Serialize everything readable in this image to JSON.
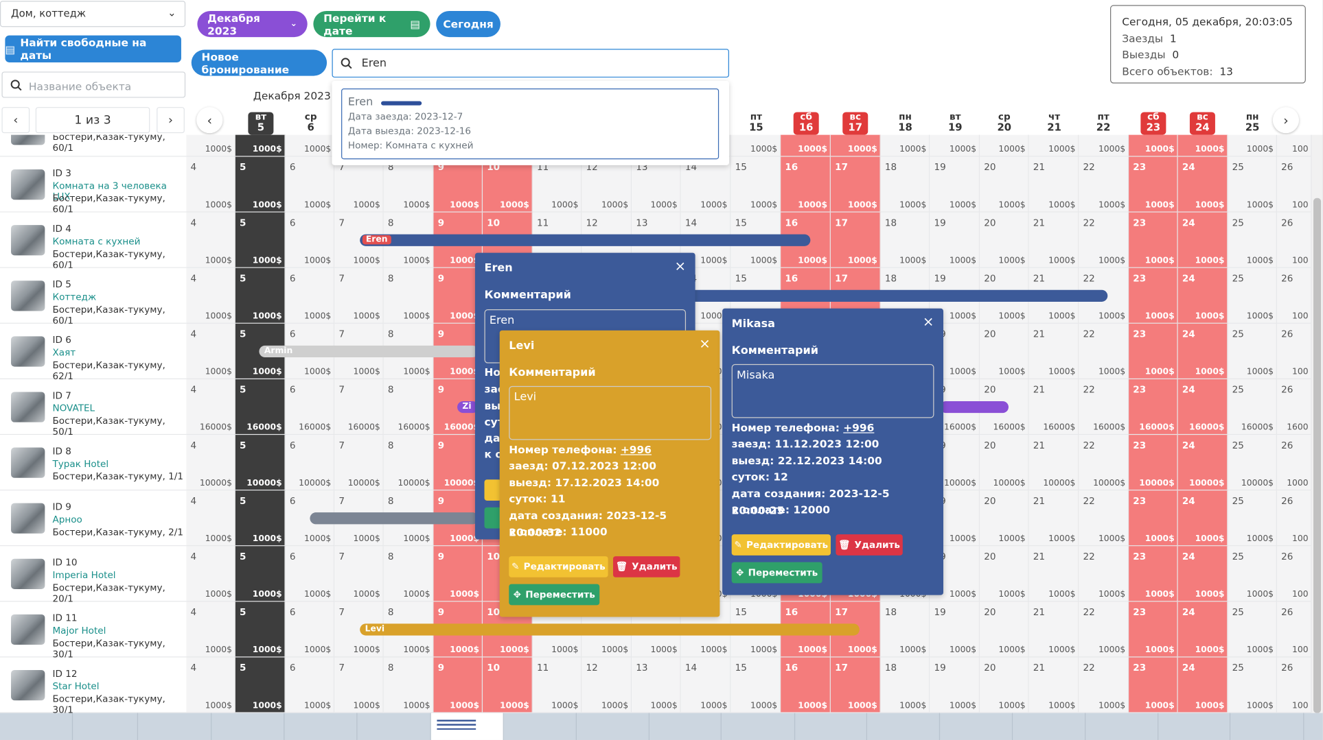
{
  "sidebar": {
    "type_select": "Дом, коттедж",
    "find_free": "Найти свободные на даты",
    "search_placeholder": "Название объекта",
    "pager": "1 из 3",
    "prev": "‹",
    "next": "›",
    "objects": [
      {
        "id": "",
        "name": "",
        "address": "Бостери,Казак-тукуму, 60/1"
      },
      {
        "id": "ID 3",
        "name": "Комната на 3 человека LUX",
        "address": "Бостери,Казак-тукуму, 60/1"
      },
      {
        "id": "ID 4",
        "name": "Комната с кухней",
        "address": "Бостери,Казак-тукуму, 60/1"
      },
      {
        "id": "ID 5",
        "name": "Коттедж",
        "address": "Бостери,Казак-тукуму, 60/1"
      },
      {
        "id": "ID 6",
        "name": "Хаят",
        "address": "Бостери,Казак-тукуму, 62/1"
      },
      {
        "id": "ID 7",
        "name": "NOVATEL",
        "address": "Бостери,Казак-тукуму, 50/1"
      },
      {
        "id": "ID 8",
        "name": "Турак Hotel",
        "address": "Бостери,Казак-тукуму, 1/1"
      },
      {
        "id": "ID 9",
        "name": "Арноо",
        "address": "Бостери,Казак-тукуму, 2/1"
      },
      {
        "id": "ID 10",
        "name": "Imperia Hotel",
        "address": "Бостери,Казак-тукуму, 20/1"
      },
      {
        "id": "ID 11",
        "name": "Major Hotel",
        "address": "Бостери,Казак-тукуму, 30/1"
      },
      {
        "id": "ID 12",
        "name": "Star Hotel",
        "address": "Бостери,Казак-тукуму, 30/1"
      }
    ]
  },
  "toolbar": {
    "month_button": "Декабря 2023",
    "goto_date": "Перейти к дате",
    "today": "Сегодня",
    "new_booking": "Новое бронирование",
    "search_value": "Eren",
    "month_label": "Декабря 2023"
  },
  "search_result": {
    "name": "Eren",
    "checkin": "Дата заезда: 2023-12-7",
    "checkout": "Дата выезда: 2023-12-16",
    "room": "Номер: Комната с кухней"
  },
  "info": {
    "today": "Сегодня, 05 декабря, 20:03:05",
    "arrivals_label": "Заезды",
    "arrivals": "1",
    "departures_label": "Выезды",
    "departures": "0",
    "total_label": "Всего объектов:",
    "total": "13"
  },
  "days": [
    {
      "dow": "вт",
      "n": "5",
      "kind": "today"
    },
    {
      "dow": "ср",
      "n": "6",
      "kind": "normal"
    },
    {
      "dow": "пт",
      "n": "15",
      "kind": "normal"
    },
    {
      "dow": "сб",
      "n": "16",
      "kind": "weekend"
    },
    {
      "dow": "вс",
      "n": "17",
      "kind": "weekend"
    },
    {
      "dow": "пн",
      "n": "18",
      "kind": "normal"
    },
    {
      "dow": "вт",
      "n": "19",
      "kind": "normal"
    },
    {
      "dow": "ср",
      "n": "20",
      "kind": "normal"
    },
    {
      "dow": "чт",
      "n": "21",
      "kind": "normal"
    },
    {
      "dow": "пт",
      "n": "22",
      "kind": "normal"
    },
    {
      "dow": "сб",
      "n": "23",
      "kind": "weekend"
    },
    {
      "dow": "вс",
      "n": "24",
      "kind": "weekend"
    },
    {
      "dow": "пн",
      "n": "25",
      "kind": "normal"
    }
  ],
  "grid": {
    "cols": [
      "4",
      "5",
      "6",
      "7",
      "8",
      "9",
      "10",
      "11",
      "12",
      "13",
      "14",
      "15",
      "16",
      "17",
      "18",
      "19",
      "20",
      "21",
      "22",
      "23",
      "24",
      "25",
      "26"
    ],
    "weekend_cols": [
      "9",
      "10",
      "16",
      "17",
      "23",
      "24"
    ],
    "today_col": "5",
    "row_prices": [
      "1000$",
      "1000$",
      "1000$",
      "1000$",
      "1000$",
      "16000$",
      "10000$",
      "1000$",
      "1000$",
      "1000$",
      "1000$"
    ],
    "last_price_cut": {
      "1000$": "100",
      "16000$": "1600",
      "10000$": "1000"
    }
  },
  "bars": {
    "eren": "Eren",
    "armin": "Armin",
    "zi": "Zi",
    "levi": "Levi"
  },
  "colors": {
    "blue": "#2c85d6",
    "purple": "#8a4fd6",
    "green": "#2fa06a",
    "weekend": "#f47c7c",
    "today": "#3d3d3d",
    "popup_blue": "#3c5a99",
    "popup_gold": "#d9a12a"
  },
  "popup_eren": {
    "title": "Eren",
    "comment_label": "Комментарий",
    "comment": "Eren",
    "cut1": "Но",
    "cut2": "зае",
    "cut3": "вые",
    "cut4": "сут",
    "cut5": "дат",
    "cut6": "к о"
  },
  "popup_levi": {
    "title": "Levi",
    "comment_label": "Комментарий",
    "comment": "Levi",
    "phone_label": "Номер телефона:",
    "phone": "+996",
    "checkin": "заезд: 07.12.2023 12:00",
    "checkout": "выезд: 17.12.2023 14:00",
    "days": "суток: 11",
    "created": "дата создания: 2023-12-5 20:00:32",
    "pay": "к оплате:  11000",
    "edit": "Редактировать",
    "delete": "Удалить",
    "move": "Переместить"
  },
  "popup_mikasa": {
    "title": "Mikasa",
    "comment_label": "Комментарий",
    "comment": "Misaka",
    "phone_label": "Номер телефона:",
    "phone": "+996",
    "checkin": "заезд: 11.12.2023 12:00",
    "checkout": "выезд: 22.12.2023 14:00",
    "days": "суток: 12",
    "created": "дата создания: 2023-12-5 20:00:25",
    "pay": "к оплате:  12000",
    "edit": "Редактировать",
    "delete": "Удалить",
    "move": "Переместить"
  }
}
